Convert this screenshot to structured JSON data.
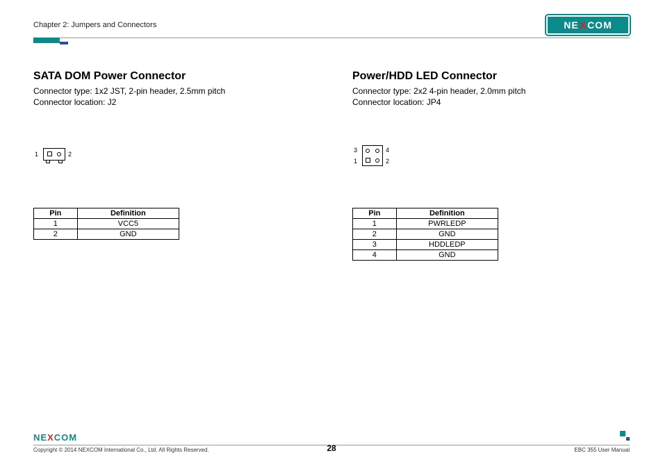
{
  "header": {
    "chapter": "Chapter 2: Jumpers and Connectors",
    "logo_text_1": "NE",
    "logo_text_x": "X",
    "logo_text_2": "COM"
  },
  "left": {
    "title": "SATA DOM Power Connector",
    "type": "Connector type: 1x2 JST, 2-pin header, 2.5mm pitch",
    "location": "Connector location: J2",
    "pin1_label": "1",
    "pin2_label": "2",
    "table": {
      "h_pin": "Pin",
      "h_def": "Definition",
      "rows": [
        {
          "pin": "1",
          "def": "VCC5"
        },
        {
          "pin": "2",
          "def": "GND"
        }
      ]
    }
  },
  "right": {
    "title": "Power/HDD LED Connector",
    "type": "Connector type: 2x2 4-pin header, 2.0mm pitch",
    "location": "Connector location: JP4",
    "pin1_label": "1",
    "pin2_label": "2",
    "pin3_label": "3",
    "pin4_label": "4",
    "table": {
      "h_pin": "Pin",
      "h_def": "Definition",
      "rows": [
        {
          "pin": "1",
          "def": "PWRLEDP"
        },
        {
          "pin": "2",
          "def": "GND"
        },
        {
          "pin": "3",
          "def": "HDDLEDP"
        },
        {
          "pin": "4",
          "def": "GND"
        }
      ]
    }
  },
  "footer": {
    "copyright": "Copyright © 2014 NEXCOM International Co., Ltd. All Rights Reserved.",
    "page": "28",
    "manual": "EBC 355 User Manual"
  }
}
